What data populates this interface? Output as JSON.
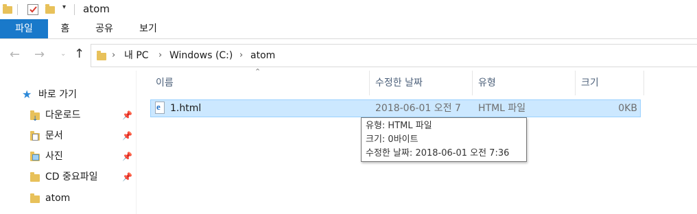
{
  "window": {
    "title": "atom"
  },
  "ribbon": {
    "tabs": [
      "파일",
      "홈",
      "공유",
      "보기"
    ]
  },
  "address": {
    "crumbs": [
      "내 PC",
      "Windows (C:)",
      "atom"
    ]
  },
  "sidebar": {
    "quick_access": "바로 가기",
    "items": [
      {
        "label": "다운로드",
        "pinned": true
      },
      {
        "label": "문서",
        "pinned": true
      },
      {
        "label": "사진",
        "pinned": true
      },
      {
        "label": "CD 중요파일",
        "pinned": true
      },
      {
        "label": "atom",
        "pinned": false
      }
    ]
  },
  "list": {
    "columns": [
      "이름",
      "수정한 날짜",
      "유형",
      "크기"
    ],
    "rows": [
      {
        "name": "1.html",
        "modified": "2018-06-01 오전 7",
        "type": "HTML 파일",
        "size": "0KB"
      }
    ]
  },
  "tooltip": {
    "lines": [
      "유형: HTML 파일",
      "크기: 0바이트",
      "수정한 날짜: 2018-06-01 오전 7:36"
    ]
  },
  "colors": {
    "accent": "#1979ca",
    "selection": "#cce8ff",
    "selection_border": "#99d1ff",
    "folder": "#e8c15a"
  }
}
